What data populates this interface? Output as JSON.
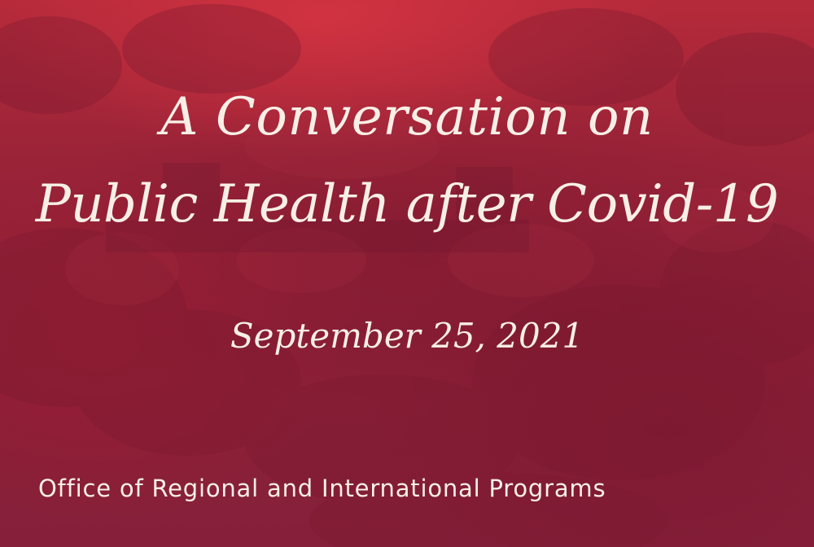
{
  "poster": {
    "title_line_1": "A Conversation on",
    "title_line_2": "Public Health after Covid-19",
    "date": "September 25, 2021",
    "organizer": "Office of Regional and International Programs"
  },
  "colors": {
    "background": "#8e2034",
    "highlight": "#d63442",
    "text": "#f7efe6"
  }
}
